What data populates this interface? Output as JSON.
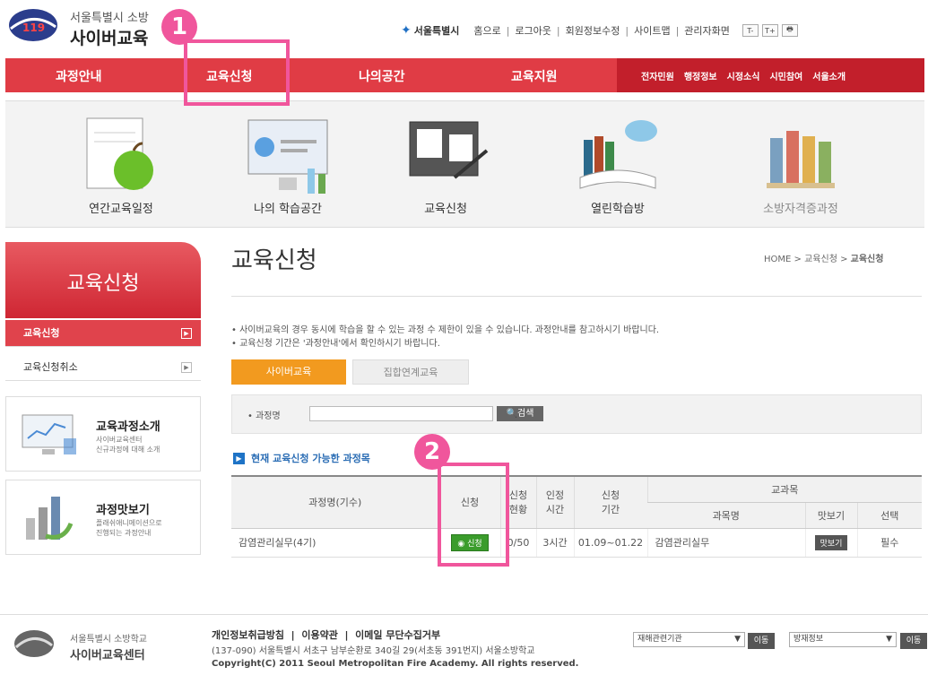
{
  "header": {
    "logo_line1": "서울특별시 소방",
    "logo_line2": "사이버교육",
    "emblem_text": "119",
    "seoul_logo": "서울특별시",
    "top_links": [
      "홈으로",
      "로그아웃",
      "회원정보수정",
      "사이트맵",
      "관리자화면"
    ],
    "font_buttons": [
      "T-",
      "T+",
      "🖶"
    ]
  },
  "nav": {
    "items": [
      "과정안내",
      "교육신청",
      "나의공간",
      "교육지원"
    ],
    "sub_items": [
      "전자민원",
      "행정정보",
      "시정소식",
      "시민참여",
      "서울소개"
    ]
  },
  "quick_menu": [
    "연간교육일정",
    "나의 학습공간",
    "교육신청",
    "열린학습방",
    "소방자격증과정"
  ],
  "sidebar": {
    "title": "교육신청",
    "items": [
      "교육신청",
      "교육신청취소"
    ],
    "promos": [
      {
        "title": "교육과정소개",
        "desc1": "사이버교육센터",
        "desc2": "신규과정에 대해 소개"
      },
      {
        "title": "과정맛보기",
        "desc1": "플래쉬애니메이션으로",
        "desc2": "진행되는 과정안내"
      }
    ]
  },
  "main": {
    "title": "교육신청",
    "breadcrumb": [
      "HOME",
      "교육신청",
      "교육신청"
    ],
    "notice1": "• 사이버교육의 경우 동시에 학습을 할 수 있는 과정 수 제한이 있을 수 있습니다. 과정안내를 참고하시기 바랍니다.",
    "notice2": "• 교육신청 기간은 '과정안내'에서 확인하시기 바랍니다.",
    "tabs": [
      "사이버교육",
      "집합연계교육"
    ],
    "search_label": "• 과정명",
    "search_value": "",
    "search_button": "검색",
    "list_heading": "현재 교육신청 가능한 과정목록",
    "list_heading_visible": "현재 교육신청 가능한 과정목",
    "table": {
      "headers": [
        "과정명(기수)",
        "신청",
        "신청현황",
        "인정시간",
        "신청기간",
        "교과목"
      ],
      "header_lines": {
        "status": [
          "신청",
          "현황"
        ],
        "hours": [
          "인정",
          "시간"
        ],
        "period": [
          "신청",
          "기간"
        ]
      },
      "sub_headers": [
        "과목명",
        "맛보기",
        "선택"
      ],
      "rows": [
        {
          "course": "감염관리실무(4기)",
          "apply": "신청",
          "status": "0/50",
          "hours": "3시간",
          "period": "01.09~01.22",
          "subject": "감염관리실무",
          "preview": "맛보기",
          "choice": "필수"
        }
      ]
    }
  },
  "annotations": [
    "1",
    "2"
  ],
  "footer": {
    "name1": "서울특별시 소방학교",
    "name2": "사이버교육센터",
    "links": [
      "개인정보취급방침",
      "이용약관",
      "이메일 무단수집거부"
    ],
    "address": "(137-090) 서울특별시 서초구 남부순환로 340길 29(서초동 391번지) 서울소방학교",
    "copyright": "Copyright(C) 2011 Seoul Metropolitan Fire Academy. All rights reserved.",
    "select1": "재해관련기관",
    "select2": "방재정보",
    "go_label": "이동"
  }
}
